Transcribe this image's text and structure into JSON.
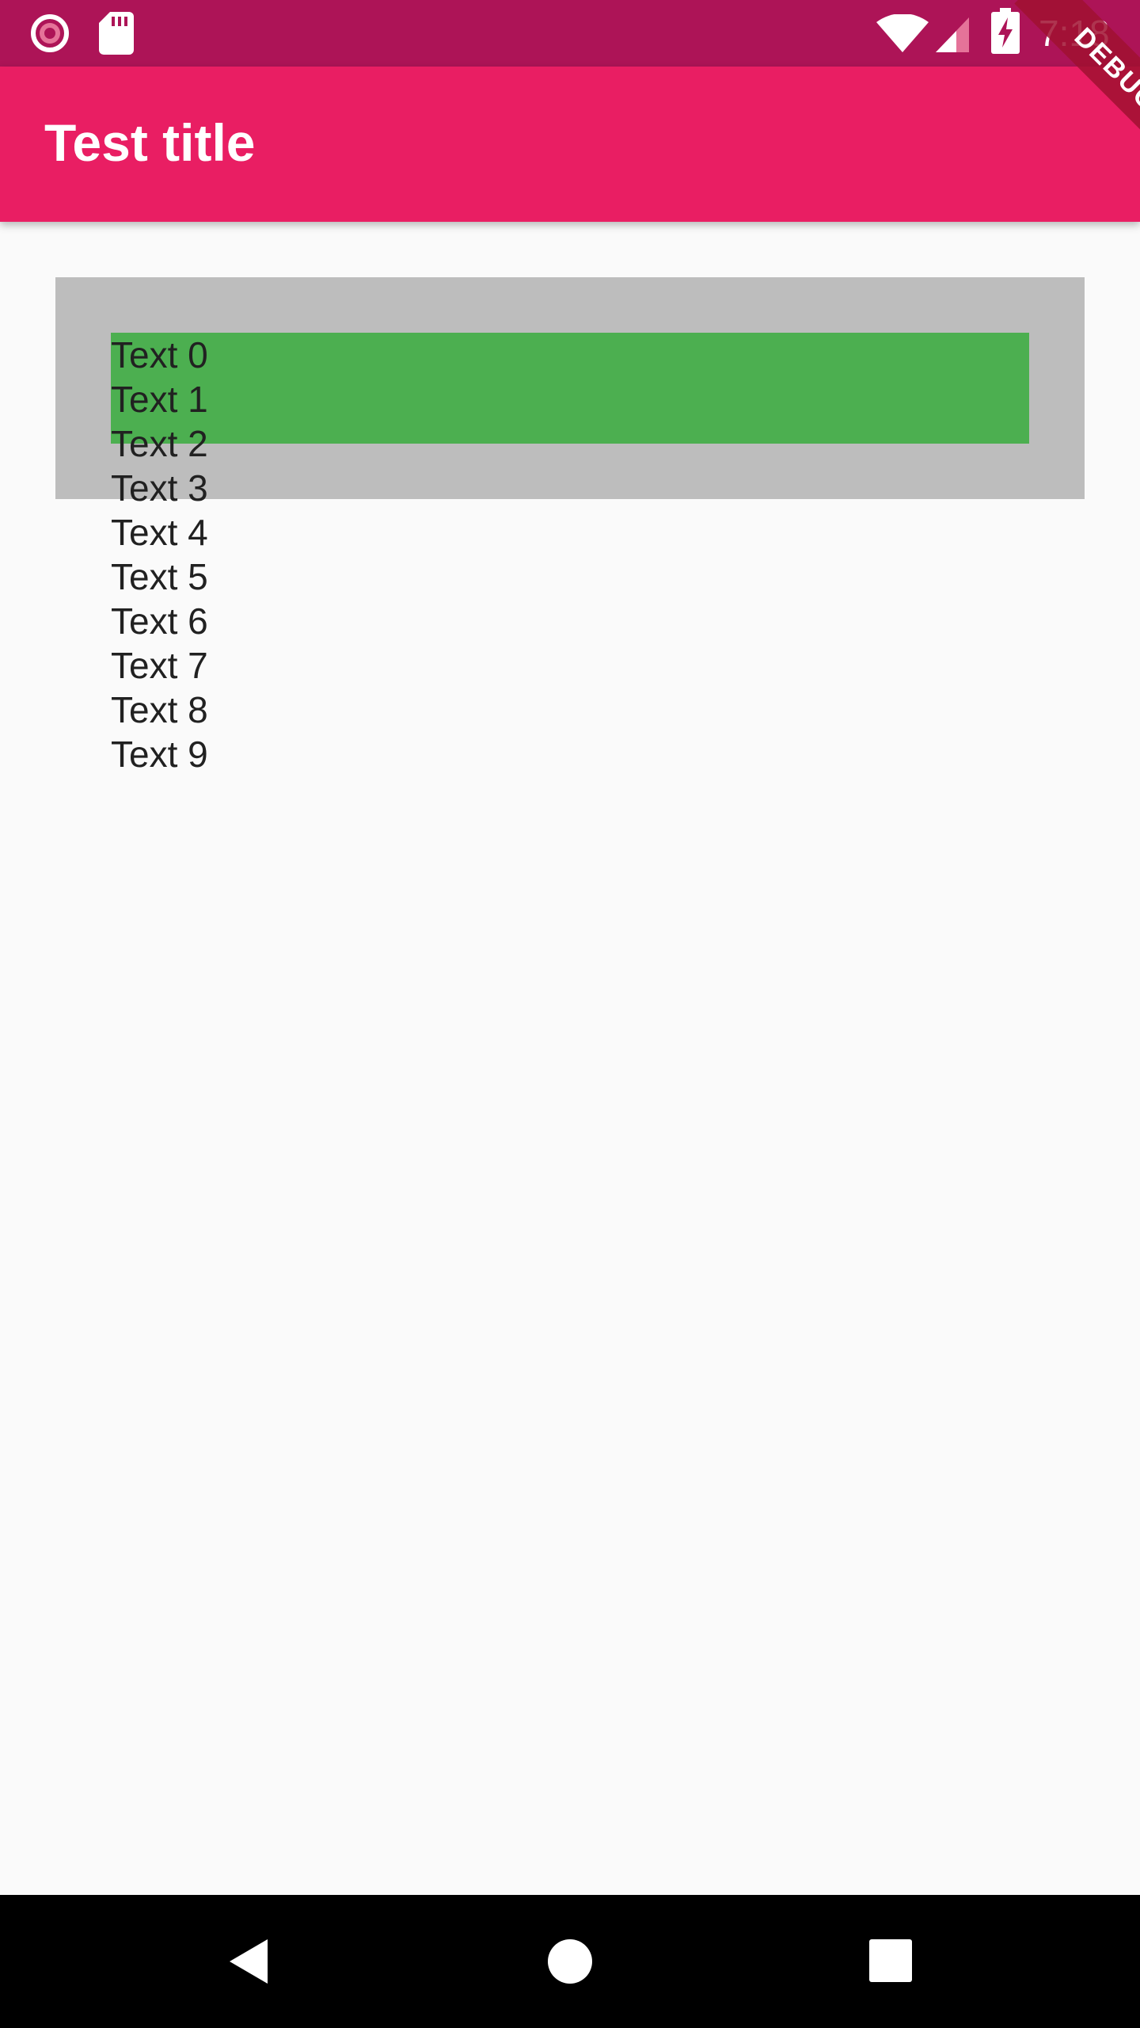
{
  "status_bar": {
    "time": "7:18",
    "icons": [
      "record-icon",
      "sd-card-icon",
      "wifi-icon",
      "signal-icon",
      "battery-charging-icon"
    ],
    "background_color": "#ad1457"
  },
  "app_bar": {
    "title": "Test title",
    "background_color": "#e91e63"
  },
  "debug_banner": {
    "label": "DEBUG"
  },
  "content": {
    "outer_box_color": "#bdbdbd",
    "inner_box_color": "#4caf50",
    "items": [
      "Text 0",
      "Text 1",
      "Text 2",
      "Text 3",
      "Text 4",
      "Text 5",
      "Text 6",
      "Text 7",
      "Text 8",
      "Text 9"
    ]
  },
  "nav_bar": {
    "buttons": [
      "back-icon",
      "home-icon",
      "recents-icon"
    ]
  }
}
